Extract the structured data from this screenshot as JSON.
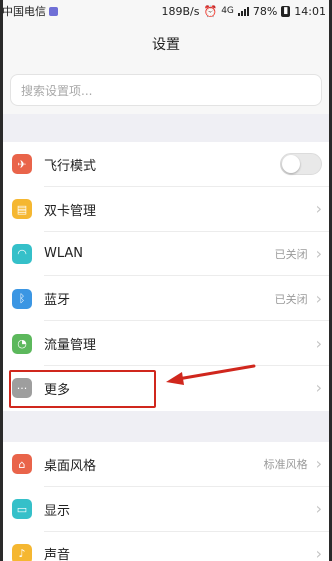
{
  "status_bar": {
    "carrier": "中国电信",
    "speed": "189B/s",
    "network": "4G",
    "battery": "78%",
    "time": "14:01"
  },
  "header": {
    "title": "设置"
  },
  "search": {
    "placeholder": "搜索设置项..."
  },
  "group1": {
    "items": [
      {
        "label": "飞行模式",
        "icon": "airplane-icon",
        "color": "#e9644a",
        "toggle": false
      },
      {
        "label": "双卡管理",
        "icon": "sim-card-icon",
        "color": "#f5b731"
      },
      {
        "label": "WLAN",
        "icon": "wifi-icon",
        "color": "#35c0c9",
        "value": "已关闭"
      },
      {
        "label": "蓝牙",
        "icon": "bluetooth-icon",
        "color": "#3b96e3",
        "value": "已关闭"
      },
      {
        "label": "流量管理",
        "icon": "data-usage-icon",
        "color": "#5cb85c"
      },
      {
        "label": "更多",
        "icon": "more-dots-icon",
        "color": "#9e9e9e"
      }
    ]
  },
  "group2": {
    "items": [
      {
        "label": "桌面风格",
        "icon": "home-style-icon",
        "color": "#e9644a",
        "value": "标准风格"
      },
      {
        "label": "显示",
        "icon": "display-icon",
        "color": "#35c0c9"
      },
      {
        "label": "声音",
        "icon": "sound-icon",
        "color": "#f5b731"
      }
    ]
  },
  "annotation": {
    "color": "#d0271d"
  }
}
